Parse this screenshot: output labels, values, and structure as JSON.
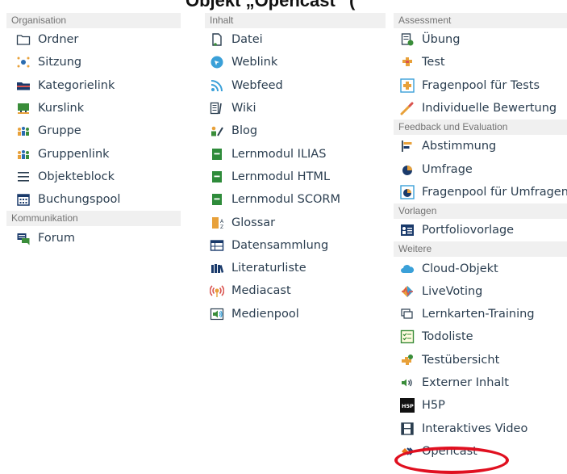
{
  "top_caption": "Objekt „Opencast“ (",
  "columns": {
    "organisation": {
      "header": "Organisation",
      "items": [
        "Ordner",
        "Sitzung",
        "Kategorielink",
        "Kurslink",
        "Gruppe",
        "Gruppenlink",
        "Objekteblock",
        "Buchungspool"
      ]
    },
    "kommunikation": {
      "header": "Kommunikation",
      "items": [
        "Forum"
      ]
    },
    "inhalt": {
      "header": "Inhalt",
      "items": [
        "Datei",
        "Weblink",
        "Webfeed",
        "Wiki",
        "Blog",
        "Lernmodul ILIAS",
        "Lernmodul HTML",
        "Lernmodul SCORM",
        "Glossar",
        "Datensammlung",
        "Literaturliste",
        "Mediacast",
        "Medienpool"
      ]
    },
    "assessment": {
      "header": "Assessment",
      "items": [
        "Übung",
        "Test",
        "Fragenpool für Tests",
        "Individuelle Bewertung"
      ]
    },
    "feedback": {
      "header": "Feedback und Evaluation",
      "items": [
        "Abstimmung",
        "Umfrage",
        "Fragenpool für Umfragen"
      ]
    },
    "vorlagen": {
      "header": "Vorlagen",
      "items": [
        "Portfoliovorlage"
      ]
    },
    "weitere": {
      "header": "Weitere",
      "items": [
        "Cloud-Objekt",
        "LiveVoting",
        "Lernkarten-Training",
        "Todoliste",
        "Testübersicht",
        "Externer Inhalt",
        "H5P",
        "Interaktives Video",
        "Opencast"
      ]
    }
  },
  "colors": {
    "highlight": "#e01020",
    "header_bg": "#f0f0f0",
    "text": "#2b3e50"
  }
}
